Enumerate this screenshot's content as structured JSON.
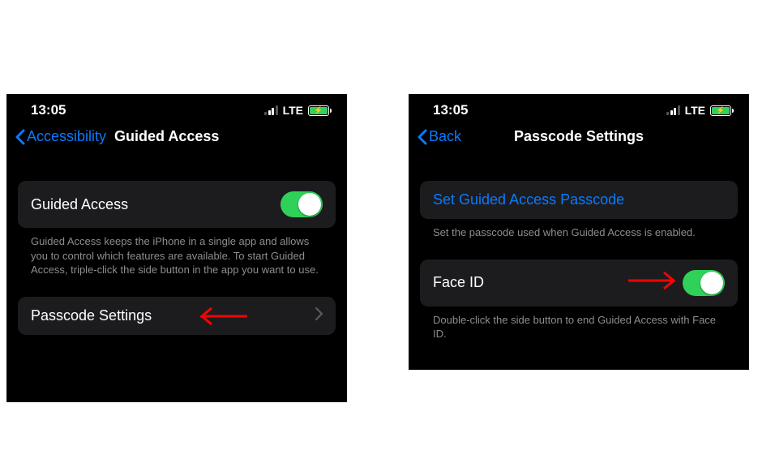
{
  "status": {
    "time": "13:05",
    "network": "LTE"
  },
  "left": {
    "back_label": "Accessibility",
    "title": "Guided Access",
    "toggle_row": {
      "label": "Guided Access"
    },
    "description": "Guided Access keeps the iPhone in a single app and allows you to control which features are available. To start Guided Access, triple-click the side button in the app you want to use.",
    "passcode_row": {
      "label": "Passcode Settings"
    }
  },
  "right": {
    "back_label": "Back",
    "title": "Passcode Settings",
    "set_passcode_row": {
      "label": "Set Guided Access Passcode"
    },
    "set_passcode_footer": "Set the passcode used when Guided Access is enabled.",
    "faceid_row": {
      "label": "Face ID"
    },
    "faceid_footer": "Double-click the side button to end Guided Access with Face ID."
  }
}
